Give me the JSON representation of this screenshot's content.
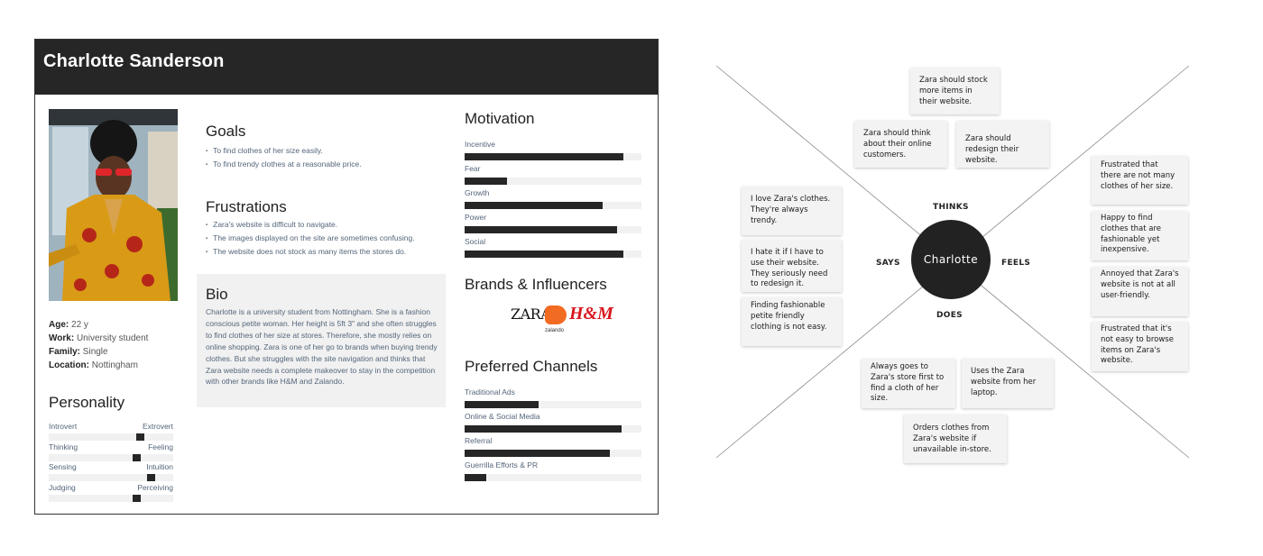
{
  "persona": {
    "name": "Charlotte Sanderson",
    "photo_alt": "Portrait of Charlotte wearing red sunglasses and a yellow patterned coat",
    "info": [
      {
        "label": "Age:",
        "value": "22 y"
      },
      {
        "label": "Work:",
        "value": "University student"
      },
      {
        "label": "Family:",
        "value": "Single"
      },
      {
        "label": "Location:",
        "value": "Nottingham"
      }
    ],
    "personality": {
      "title": "Personality",
      "traits": [
        {
          "left": "Introvert",
          "right": "Extrovert",
          "position": 0.73
        },
        {
          "left": "Thinking",
          "right": "Feeling",
          "position": 0.7
        },
        {
          "left": "Sensing",
          "right": "Intuition",
          "position": 0.82
        },
        {
          "left": "Judging",
          "right": "Perceiving",
          "position": 0.7
        }
      ]
    },
    "goals": {
      "title": "Goals",
      "items": [
        "To find clothes of her size easily.",
        "To find trendy clothes at a reasonable price."
      ]
    },
    "frustrations": {
      "title": "Frustrations",
      "items": [
        "Zara's website is difficult to navigate.",
        "The images displayed on the site are sometimes confusing.",
        "The website does not stock as many items the stores do."
      ]
    },
    "bio": {
      "title": "Bio",
      "text": "Charlotte is a university student from Nottingham. She is a fashion conscious petite woman. Her height is 5ft 3\" and she often struggles to find clothes of her size at stores. Therefore, she mostly relies on online shopping. Zara is one of her go to brands when buying trendy clothes. But she struggles with the site navigation and thinks that Zara website needs a complete makeover to stay in the competition with other brands like H&M and Zalando."
    },
    "motivation": {
      "title": "Motivation",
      "items": [
        {
          "label": "Incentive",
          "value": 0.9
        },
        {
          "label": "Fear",
          "value": 0.24
        },
        {
          "label": "Growth",
          "value": 0.78
        },
        {
          "label": "Power",
          "value": 0.86
        },
        {
          "label": "Social",
          "value": 0.9
        }
      ]
    },
    "brands": {
      "title": "Brands & Influencers",
      "logos": [
        "ZARA",
        "zalando",
        "H&M"
      ]
    },
    "channels": {
      "title": "Preferred Channels",
      "items": [
        {
          "label": "Traditional Ads",
          "value": 0.42
        },
        {
          "label": "Online & Social Media",
          "value": 0.89
        },
        {
          "label": "Referral",
          "value": 0.82
        },
        {
          "label": "Guerrilla Efforts & PR",
          "value": 0.12
        }
      ]
    }
  },
  "empathy_map": {
    "center": "Charlotte",
    "quadrants": {
      "thinks": "THINKS",
      "says": "SAYS",
      "feels": "FEELS",
      "does": "DOES"
    },
    "thinks": [
      "Zara should stock more items in their website.",
      "Zara should think about their online customers.",
      "Zara should redesign their website."
    ],
    "says": [
      "I love Zara's clothes. They're always trendy.",
      "I hate it if I have to use their website. They seriously need to redesign it.",
      "Finding fashionable petite friendly clothing is not easy."
    ],
    "feels": [
      "Frustrated that there are not many clothes of her size.",
      "Happy to find clothes that are fashionable yet inexpensive.",
      "Annoyed that Zara's website is not at all user-friendly.",
      "Frustrated that it's not easy to browse items on Zara's website."
    ],
    "does": [
      "Always goes to Zara's store first to find a cloth of her size.",
      "Uses the Zara website from her laptop.",
      "Orders clothes from Zara's website if unavailable in-store."
    ]
  }
}
